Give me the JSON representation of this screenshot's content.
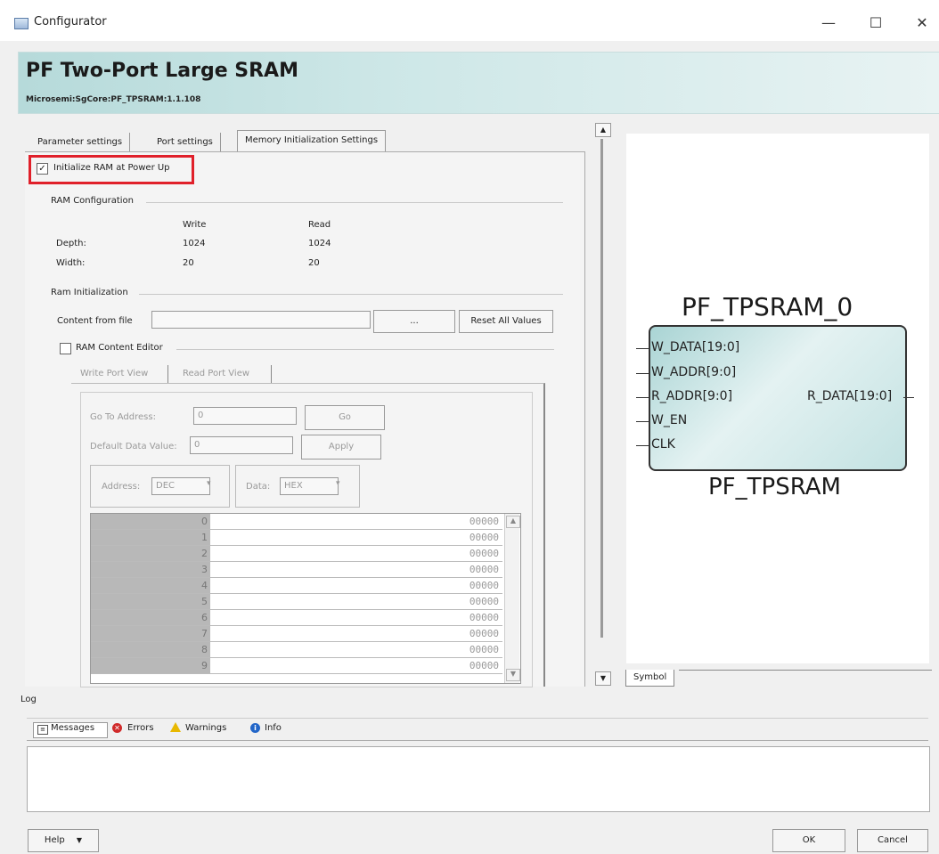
{
  "window": {
    "title": "Configurator",
    "controls": {
      "minimize": "—",
      "maximize": "☐",
      "close": "✕"
    }
  },
  "header": {
    "title": "PF Two-Port Large SRAM",
    "subtitle": "Microsemi:SgCore:PF_TPSRAM:1.1.108"
  },
  "tabs": [
    {
      "label": "Parameter settings"
    },
    {
      "label": "Port settings"
    },
    {
      "label": "Memory Initialization Settings",
      "active": true
    }
  ],
  "init_checkbox": {
    "label": "Initialize RAM at Power Up",
    "checked": "✓"
  },
  "ram_config": {
    "title": "RAM Configuration",
    "col_write": "Write",
    "col_read": "Read",
    "depth_label": "Depth:",
    "depth_write": "1024",
    "depth_read": "1024",
    "width_label": "Width:",
    "width_write": "20",
    "width_read": "20"
  },
  "ram_init": {
    "title": "Ram Initialization",
    "content_label": "Content from file",
    "content_value": "",
    "browse_label": "...",
    "reset_label": "Reset All Values"
  },
  "editor": {
    "checkbox_label": "RAM Content Editor",
    "tab_write": "Write Port View",
    "tab_read": "Read Port  View",
    "goto_label": "Go To Address:",
    "goto_value": "0",
    "go_button": "Go",
    "default_label": "Default Data Value:",
    "default_value": "0",
    "apply_button": "Apply",
    "address_label": "Address:",
    "address_value": "DEC",
    "data_label": "Data:",
    "data_value": "HEX",
    "rows": [
      {
        "addr": "0",
        "val": "00000"
      },
      {
        "addr": "1",
        "val": "00000"
      },
      {
        "addr": "2",
        "val": "00000"
      },
      {
        "addr": "3",
        "val": "00000"
      },
      {
        "addr": "4",
        "val": "00000"
      },
      {
        "addr": "5",
        "val": "00000"
      },
      {
        "addr": "6",
        "val": "00000"
      },
      {
        "addr": "7",
        "val": "00000"
      },
      {
        "addr": "8",
        "val": "00000"
      },
      {
        "addr": "9",
        "val": "00000"
      }
    ]
  },
  "symbol": {
    "instance": "PF_TPSRAM_0",
    "component": "PF_TPSRAM",
    "ports_left": [
      "W_DATA[19:0]",
      "W_ADDR[9:0]",
      "R_ADDR[9:0]",
      "W_EN",
      "CLK"
    ],
    "port_right": "R_DATA[19:0]",
    "tab_label": "Symbol"
  },
  "log": {
    "title": "Log",
    "tab_messages": "Messages",
    "tab_errors": "Errors",
    "tab_warnings": "Warnings",
    "tab_info": "Info"
  },
  "footer": {
    "help_label": "Help",
    "ok_label": "OK",
    "cancel_label": "Cancel"
  },
  "colors": {
    "highlight_box": "#e0202a",
    "header_accent": "#b6dada"
  }
}
